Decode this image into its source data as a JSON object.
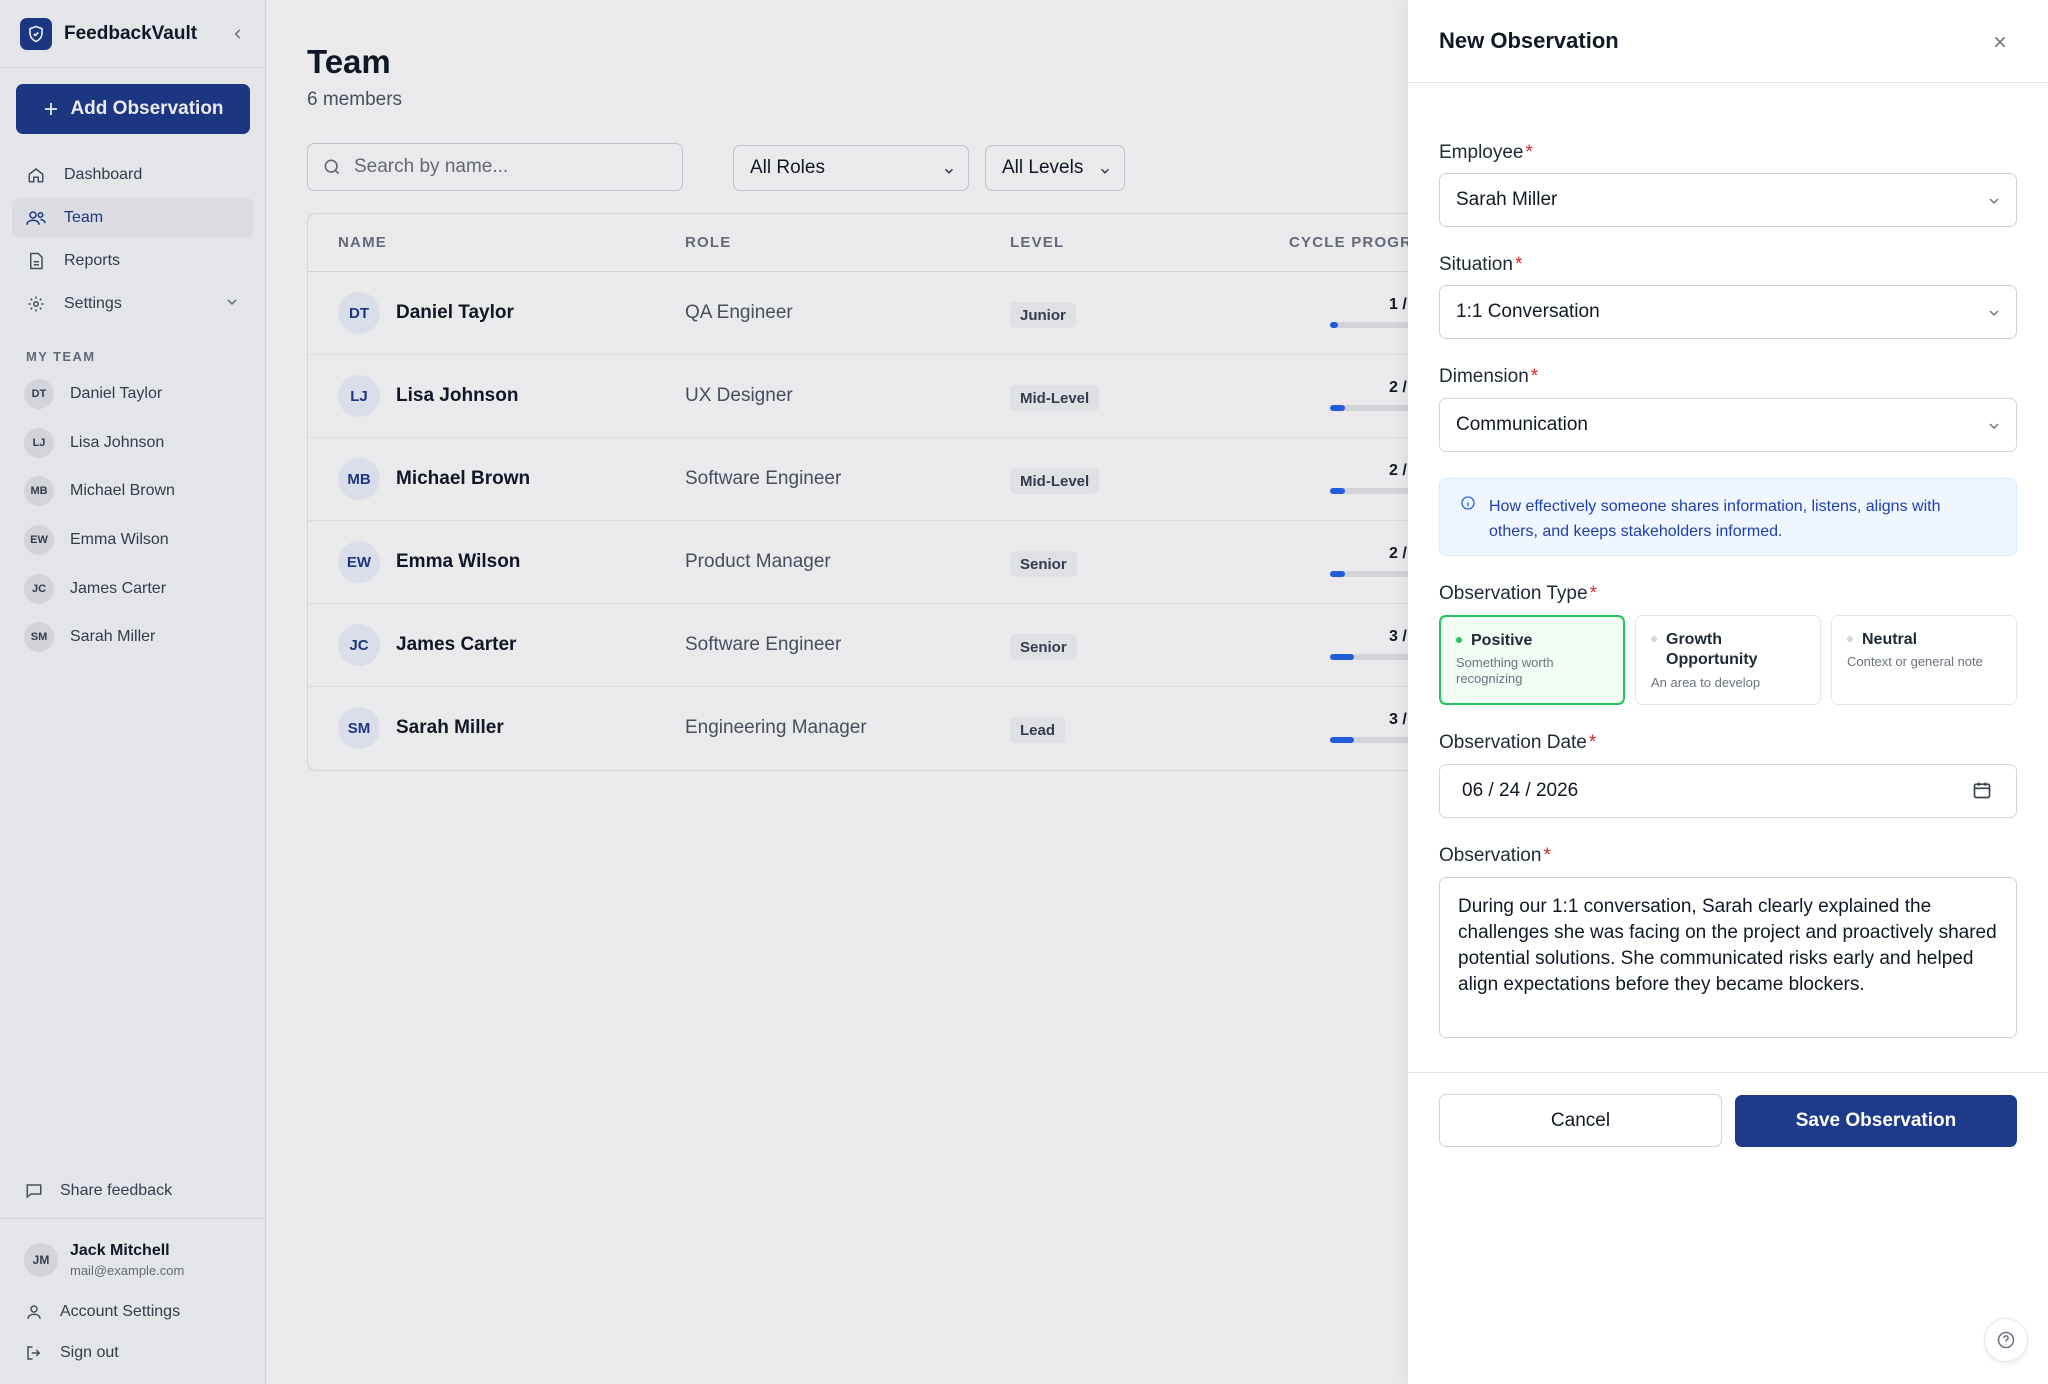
{
  "brand": {
    "name": "FeedbackVault"
  },
  "sidebar": {
    "add_button": "Add Observation",
    "nav": [
      {
        "label": "Dashboard",
        "icon": "home-icon"
      },
      {
        "label": "Team",
        "icon": "users-icon"
      },
      {
        "label": "Reports",
        "icon": "document-icon"
      },
      {
        "label": "Settings",
        "icon": "gear-icon"
      }
    ],
    "section_label": "MY TEAM",
    "team": [
      {
        "initials": "DT",
        "name": "Daniel Taylor"
      },
      {
        "initials": "LJ",
        "name": "Lisa Johnson"
      },
      {
        "initials": "MB",
        "name": "Michael Brown"
      },
      {
        "initials": "EW",
        "name": "Emma Wilson"
      },
      {
        "initials": "JC",
        "name": "James Carter"
      },
      {
        "initials": "SM",
        "name": "Sarah Miller"
      }
    ],
    "share_feedback": "Share feedback",
    "user": {
      "initials": "JM",
      "name": "Jack Mitchell",
      "email": "mail@example.com"
    },
    "account_settings": "Account Settings",
    "sign_out": "Sign out"
  },
  "main": {
    "title": "Team",
    "subtitle": "6 members",
    "search_placeholder": "Search by name...",
    "filters": {
      "roles": "All Roles",
      "levels": "All Levels"
    },
    "columns": {
      "name": "NAME",
      "role": "ROLE",
      "level": "LEVEL",
      "progress": "CYCLE PROGRE"
    },
    "rows": [
      {
        "initials": "DT",
        "name": "Daniel Taylor",
        "role": "QA Engineer",
        "level": "Junior",
        "progress_text": "1 /",
        "progress": 0.06
      },
      {
        "initials": "LJ",
        "name": "Lisa Johnson",
        "role": "UX Designer",
        "level": "Mid-Level",
        "progress_text": "2 /",
        "progress": 0.11
      },
      {
        "initials": "MB",
        "name": "Michael Brown",
        "role": "Software Engineer",
        "level": "Mid-Level",
        "progress_text": "2 /",
        "progress": 0.11
      },
      {
        "initials": "EW",
        "name": "Emma Wilson",
        "role": "Product Manager",
        "level": "Senior",
        "progress_text": "2 /",
        "progress": 0.11
      },
      {
        "initials": "JC",
        "name": "James Carter",
        "role": "Software Engineer",
        "level": "Senior",
        "progress_text": "3 /",
        "progress": 0.17
      },
      {
        "initials": "SM",
        "name": "Sarah Miller",
        "role": "Engineering Manager",
        "level": "Lead",
        "progress_text": "3 /",
        "progress": 0.17
      }
    ]
  },
  "drawer": {
    "title": "New Observation",
    "required_mark": "*",
    "employee_label": "Employee",
    "employee_value": "Sarah Miller",
    "situation_label": "Situation",
    "situation_value": "1:1 Conversation",
    "dimension_label": "Dimension",
    "dimension_value": "Communication",
    "dimension_info": "How effectively someone shares information, listens, aligns with others, and keeps stakeholders informed.",
    "type_label": "Observation Type",
    "types": [
      {
        "title": "Positive",
        "desc": "Something worth recognizing"
      },
      {
        "title": "Growth Opportunity",
        "desc": "An area to develop"
      },
      {
        "title": "Neutral",
        "desc": "Context or general note"
      }
    ],
    "date_label": "Observation Date",
    "date_value": "06 / 24 / 2026",
    "observation_label": "Observation",
    "observation_text": "During our 1:1 conversation, Sarah clearly explained the challenges she was facing on the project and proactively shared potential solutions. She communicated risks early and helped align expectations before they became blockers.",
    "cancel": "Cancel",
    "save": "Save Observation"
  },
  "colors": {
    "brand": "#1e3a8a",
    "accent": "#2563eb",
    "positive": "#22c55e",
    "required": "#dc2626"
  }
}
